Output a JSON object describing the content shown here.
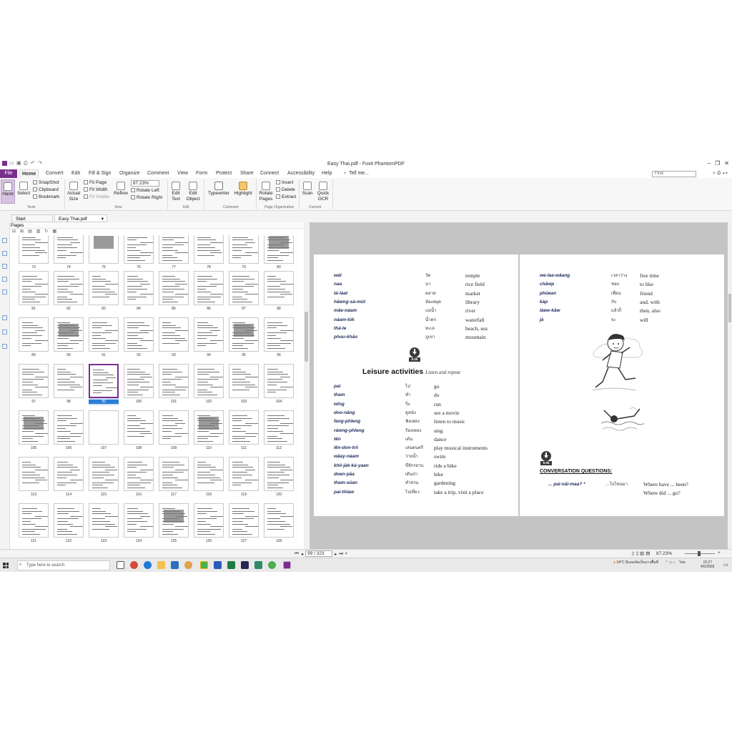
{
  "window": {
    "title": "Easy Thai.pdf - Foxit PhantomPDF"
  },
  "menu": {
    "file": "File",
    "tabs": [
      "Home",
      "Convert",
      "Edit",
      "Fill & Sign",
      "Organize",
      "Comment",
      "View",
      "Form",
      "Protect",
      "Share",
      "Connect",
      "Accessibility",
      "Help"
    ],
    "tell_me": "Tell me...",
    "find_placeholder": "Find"
  },
  "ribbon": {
    "hand": "Hand",
    "select": "Select",
    "snapshot": "SnapShot",
    "clipboard": "Clipboard",
    "bookmark": "Bookmark",
    "actual_size": "Actual Size",
    "fit_page": "Fit Page",
    "fit_width": "Fit Width",
    "fit_visible": "Fit Visible",
    "reflow": "Reflow",
    "zoom_value": "87.23%",
    "rotate_left": "Rotate Left",
    "rotate_right": "Rotate Right",
    "edit_text": "Edit Text",
    "edit_object": "Edit Object",
    "typewriter": "Typewriter",
    "highlight": "Highlight",
    "rotate_pages": "Rotate Pages",
    "insert": "Insert",
    "delete": "Delete",
    "extract": "Extract",
    "scan": "Scan",
    "quick_ocr": "Quick OCR",
    "groups": {
      "tools": "Tools",
      "view": "View",
      "edit": "Edit",
      "comment": "Comment",
      "page_organization": "Page Organization",
      "convert": "Convert"
    }
  },
  "doc_tabs": {
    "start": "Start",
    "file": "Easy Thai.pdf"
  },
  "pages_panel": {
    "title": "Pages",
    "page_numbers": [
      [
        "73",
        "74",
        "75",
        "76",
        "77",
        "78",
        "79",
        "80"
      ],
      [
        "81",
        "82",
        "83",
        "84",
        "85",
        "86",
        "87",
        "88"
      ],
      [
        "89",
        "90",
        "91",
        "92",
        "93",
        "94",
        "95",
        "96"
      ],
      [
        "97",
        "98",
        "99",
        "100",
        "101",
        "102",
        "103",
        "104"
      ],
      [
        "105",
        "106",
        "107",
        "108",
        "109",
        "110",
        "111",
        "112"
      ],
      [
        "113",
        "114",
        "115",
        "116",
        "117",
        "118",
        "119",
        "120"
      ],
      [
        "121",
        "122",
        "123",
        "124",
        "125",
        "126",
        "127",
        "128"
      ]
    ],
    "selected": "99"
  },
  "page_left": {
    "vocab1": [
      {
        "tr": "wát",
        "th": "วัด",
        "en": "temple"
      },
      {
        "tr": "naa",
        "th": "นา",
        "en": "rice field"
      },
      {
        "tr": "tà-làat",
        "th": "ตลาด",
        "en": "market"
      },
      {
        "tr": "hâwng-sà-mùt",
        "th": "ห้องสมุด",
        "en": "library"
      },
      {
        "tr": "mâe-náam",
        "th": "แม่น้ำ",
        "en": "river"
      },
      {
        "tr": "náam-tòk",
        "th": "น้ำตก",
        "en": "waterfall"
      },
      {
        "tr": "thá-le",
        "th": "ทะเล",
        "en": "beach, sea"
      },
      {
        "tr": "phou-khăo",
        "th": "ภูเขา",
        "en": "mountain"
      }
    ],
    "audio_tag": "5.05",
    "section_title": "Leisure activities",
    "section_sub": "Listen and repeat",
    "vocab2": [
      {
        "tr": "pai",
        "th": "ไป",
        "en": "go"
      },
      {
        "tr": "tham",
        "th": "ทำ",
        "en": "do"
      },
      {
        "tr": "wîng",
        "th": "วิ่ง",
        "en": "run"
      },
      {
        "tr": "doo-năng",
        "th": "ดูหนัง",
        "en": "see a movie"
      },
      {
        "tr": "fang-phleng",
        "th": "ฟังเพลง",
        "en": "listen to music"
      },
      {
        "tr": "ráwng-phleng",
        "th": "ร้องเพลง",
        "en": "sing"
      },
      {
        "tr": "tên",
        "th": "เต้น",
        "en": "dance"
      },
      {
        "tr": "lên-don-trii",
        "th": "เล่นดนตรี",
        "en": "play musical instruments"
      },
      {
        "tr": "wâay-náam",
        "th": "ว่ายน้ำ",
        "en": "swim"
      },
      {
        "tr": "khìi-jàk-kà-yaan",
        "th": "ขี่จักรยาน",
        "en": "ride a bike"
      },
      {
        "tr": "doen-păa",
        "th": "เดินป่า",
        "en": "hike"
      },
      {
        "tr": "tham-sŭan",
        "th": "ทำสวน",
        "en": "gardening"
      },
      {
        "tr": "pai-thîaw",
        "th": "ไปเที่ยว",
        "en": "take a trip, visit a place"
      }
    ]
  },
  "page_right": {
    "vocab": [
      {
        "tr": "we-laa-wâang",
        "th": "เวลาว่าง",
        "en": "free time"
      },
      {
        "tr": "châwp",
        "th": "ชอบ",
        "en": "to like"
      },
      {
        "tr": "phûean",
        "th": "เพื่อน",
        "en": "friend"
      },
      {
        "tr": "kàp",
        "th": "กับ",
        "en": "and, with"
      },
      {
        "tr": "láew-kâw",
        "th": "แล้วก็",
        "en": "then, also"
      },
      {
        "tr": "jà",
        "th": "จะ",
        "en": "will"
      }
    ],
    "audio_tag": "5.06",
    "conv_title": "CONVERSATION QUESTIONS:",
    "q_tr": "... pai-năi-maa? *",
    "q_th": "...ไปไหนมา",
    "q_en1": "Where have ... been?",
    "q_en2": "Where did ... go?"
  },
  "status": {
    "page_input": "99 / 323",
    "zoom": "87.23%"
  },
  "taskbar": {
    "search_placeholder": "Type here to search",
    "weather": "34°C มีแดดจัดเป็นบางพื้นที่",
    "lang": "ไทย",
    "time": "15:27",
    "date": "4/5/2566"
  }
}
